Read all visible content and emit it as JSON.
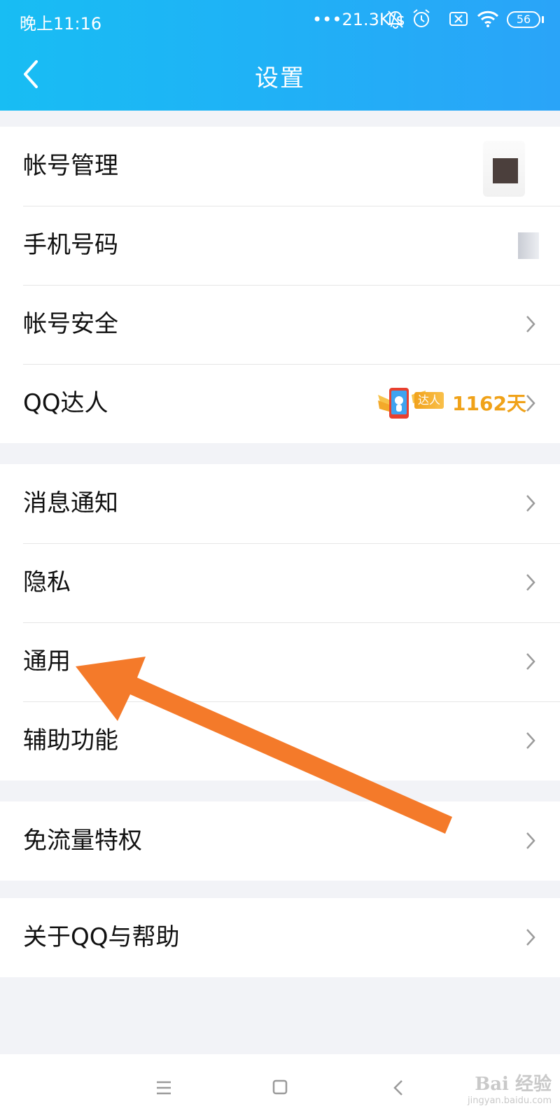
{
  "status_bar": {
    "time": "晚上11:16",
    "network_speed": "•••21.3K/s",
    "battery": "56"
  },
  "header": {
    "title": "设置"
  },
  "sections": [
    {
      "items": [
        {
          "label": "帐号管理"
        },
        {
          "label": "手机号码"
        },
        {
          "label": "帐号安全"
        },
        {
          "label": "QQ达人",
          "badge": "达人",
          "days": "1162天"
        }
      ]
    },
    {
      "items": [
        {
          "label": "消息通知"
        },
        {
          "label": "隐私"
        },
        {
          "label": "通用"
        },
        {
          "label": "辅助功能"
        }
      ]
    },
    {
      "items": [
        {
          "label": "免流量特权"
        }
      ]
    },
    {
      "items": [
        {
          "label": "关于QQ与帮助"
        }
      ]
    }
  ],
  "watermark": {
    "brand": "Bai 经验",
    "url": "jingyan.baidu.com"
  },
  "colors": {
    "header_start": "#18bdf3",
    "header_end": "#2aa4f8",
    "accent_orange": "#f47a2a",
    "days_color": "#f0a219"
  }
}
